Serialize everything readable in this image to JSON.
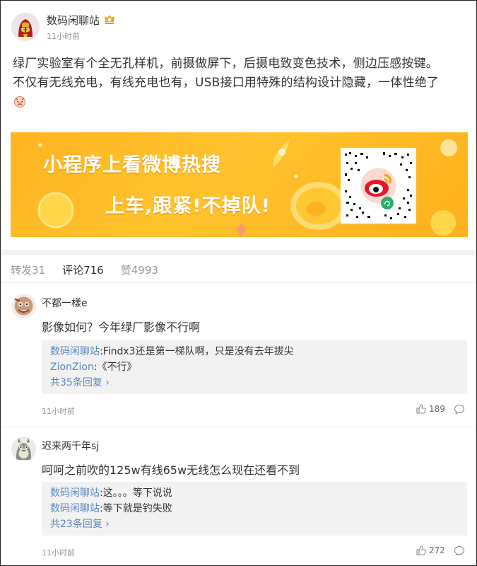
{
  "post": {
    "author": "数码闲聊站",
    "time": "11小时前",
    "text_line1": "绿厂实验室有个全无孔样机，前摄做屏下，后摄电致变色技术，侧边压感按键。",
    "text_line2": "不仅有无线充电，有线充电也有，USB接口用特殊的结构设计隐藏，一体性绝了",
    "avatar_icon": "iron-man-avatar-icon",
    "badge_icon": "vip-badge-icon",
    "emoji_icon": "emoji-icon"
  },
  "banner": {
    "line1": "小程序上看微博热搜",
    "line2": "上车,跟紧!不掉队!",
    "qr_icon": "weibo-qr-code-icon"
  },
  "tabs": [
    {
      "label": "转发31"
    },
    {
      "label": "评论716"
    },
    {
      "label": "赞4993"
    }
  ],
  "comments": [
    {
      "user": "不都一樣e",
      "text": "影像如何？今年绿厂影像不行啊",
      "replies": [
        {
          "user": "数码闲聊站",
          "text": ":Findx3还是第一梯队啊，只是没有去年拔尖"
        },
        {
          "user": "ZionZion",
          "text": ":《不行》"
        }
      ],
      "more": "共35条回复",
      "time": "11小时前",
      "likes": "189"
    },
    {
      "user": "迟来两千年sj",
      "text": "呵呵之前吹的125w有线65w无线怎么现在还看不到",
      "replies": [
        {
          "user": "数码闲聊站",
          "text": ":这。。。等下说说"
        },
        {
          "user": "数码闲聊站",
          "text": ":等下就是钓失败"
        }
      ],
      "more": "共23条回复",
      "time": "11小时前",
      "likes": "272"
    }
  ],
  "colors": {
    "link": "#5b85bf",
    "banner": "#ffb521",
    "muted": "#999999"
  }
}
